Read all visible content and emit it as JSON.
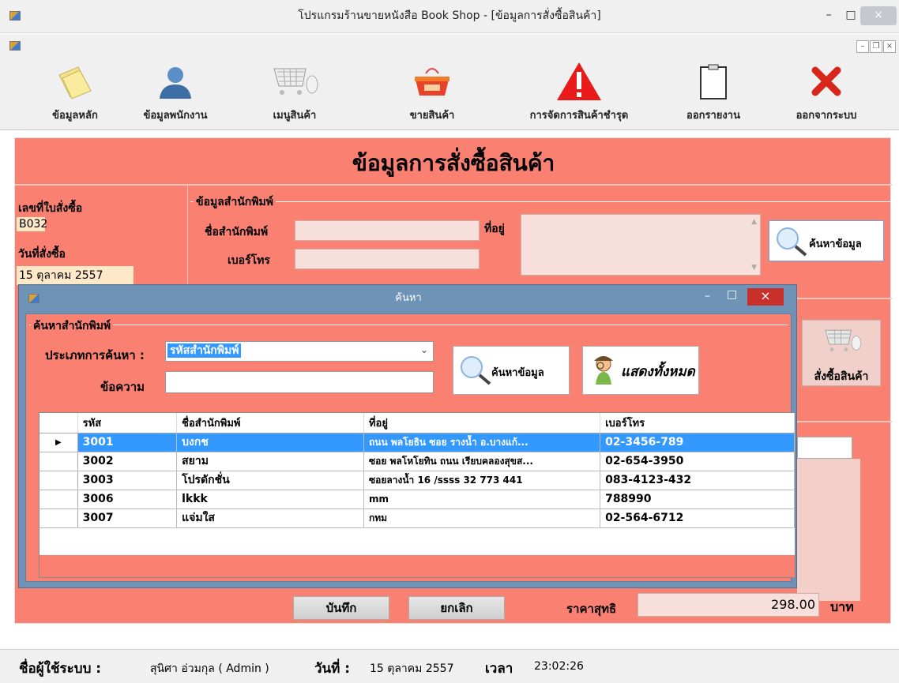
{
  "window": {
    "title": "โปรแกรมร้านขายหนังสือ Book Shop - [ข้อมูลการสั่งซื้อสินค้า]",
    "minimize": "–",
    "maximize": "□",
    "close": "×"
  },
  "mdi": {
    "minimize": "–",
    "restore": "❐",
    "close": "×"
  },
  "toolbar": {
    "items": [
      {
        "label": "ข้อมูลหลัก",
        "icon": "notes-icon"
      },
      {
        "label": "ข้อมูลพนักงาน",
        "icon": "user-icon"
      },
      {
        "label": "เมนูสินค้า",
        "icon": "cart-icon"
      },
      {
        "label": "ขายสินค้า",
        "icon": "basket-icon"
      },
      {
        "label": "การจัดการสินค้าชำรุด",
        "icon": "warning-icon"
      },
      {
        "label": "ออกรายงาน",
        "icon": "clipboard-icon"
      },
      {
        "label": "ออกจากระบบ",
        "icon": "exit-x-icon"
      }
    ]
  },
  "form": {
    "title": "ข้อมูลการสั่งซื้อสินค้า",
    "order_no_label": "เลขที่ใบสั่งซื้อ",
    "order_no": "B032",
    "order_date_label": "วันที่สั่งซื้อ",
    "order_date": "15 ตุลาคม 2557",
    "publisher_group": "ข้อมูลสำนักพิมพ์",
    "publisher_name_label": "ชื่อสำนักพิมพ์",
    "phone_label": "เบอร์โทร",
    "address_label": "ที่อยู่",
    "search_button": "ค้นหาข้อมูล",
    "order_button": "สั่งซื้อสินค้า",
    "save_button": "บันทึก",
    "cancel_button": "ยกเลิก",
    "net_price_label": "ราคาสุทธิ",
    "net_price": "298.00",
    "currency": "บาท"
  },
  "dialog": {
    "title": "ค้นหา",
    "group_label": "ค้นหาสำนักพิมพ์",
    "search_type_label": "ประเภทการค้นหา :",
    "search_type_value": "รหัสสำนักพิมพ์",
    "text_label": "ข้อความ",
    "search_button": "ค้นหาข้อมูล",
    "show_all_button": "แสดงทั้งหมด",
    "columns": [
      "รหัส",
      "ชื่อสำนักพิมพ์",
      "ที่อยู่",
      "เบอร์โทร"
    ],
    "rows": [
      {
        "id": "3001",
        "name": "บงกช",
        "address": "ถนน พลโยธิน ซอย รางน้ำ อ.บางแก้...",
        "phone": "02-3456-789",
        "selected": true
      },
      {
        "id": "3002",
        "name": "สยาม",
        "address": "ซอย พลโหโยทิน ถนน เรียบคลองสุขส...",
        "phone": "02-654-3950",
        "selected": false
      },
      {
        "id": "3003",
        "name": "โปรดักชั่น",
        "address": "ซอยลางน้ำ 16 /ssss 32 773 441",
        "phone": "083-4123-432",
        "selected": false
      },
      {
        "id": "3006",
        "name": "lkkk",
        "address": "mm",
        "phone": "788990",
        "selected": false
      },
      {
        "id": "3007",
        "name": "แจ่มใส",
        "address": "กทม",
        "phone": "02-564-6712",
        "selected": false
      }
    ]
  },
  "status": {
    "user_label": "ชื่อผู้ใช้ระบบ :",
    "user": "สุนิศา อ่วมกุล ( Admin )",
    "date_label": "วันที่ :",
    "date": "15 ตุลาคม 2557",
    "time_label": "เวลา",
    "time": "23:02:26"
  },
  "colors": {
    "form_bg": "#fa8072",
    "dialog_frame": "#6e93b6",
    "selection": "#3399ff"
  }
}
